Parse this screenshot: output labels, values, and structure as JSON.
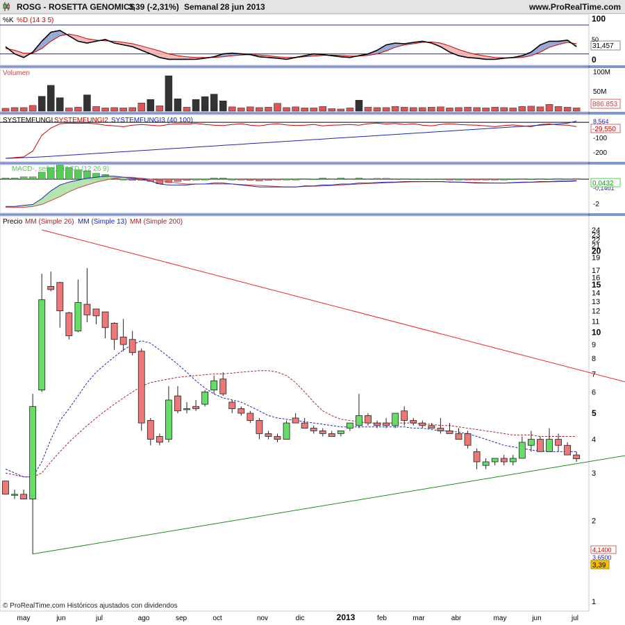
{
  "header": {
    "symbol": "ROSG - ROSETTA GENOMICS",
    "price": "3,39 (-2,31%)",
    "period": "Semanal",
    "date": "28 jun 2013",
    "site": "www.ProRealTime.com"
  },
  "panels": {
    "stochastic": {
      "label_k": "%K",
      "label_d": "%D (14 3 5)",
      "value_label": "31,457",
      "ticks": [
        "100",
        "50",
        "0"
      ],
      "colors": {
        "k": "#000000",
        "d": "#cc0000",
        "fill_up": "#8f9fcf",
        "fill_down": "#f0b4b4"
      }
    },
    "volume": {
      "label": "Volumen",
      "value_label": "886.853",
      "ticks": [
        "100M",
        "50M"
      ]
    },
    "systemfungi": {
      "label_1": "SYSTEMFUNGI",
      "label_2": "SYSTEMFUNGI2",
      "label_3": "SYSTEMFUNGI3 (40 100)",
      "value_label_blue": "8,564",
      "value_label_red": "-29,550",
      "ticks": [
        "0",
        "-100",
        "-200"
      ],
      "colors": {
        "red": "#cc0000",
        "blue": "#1f24b3"
      }
    },
    "macd": {
      "label": "MACD-, señal, MACD (12 26 9)",
      "value_label": "0,0432",
      "value_label_under": "-0,1401",
      "ticks": [
        "0",
        "-2"
      ],
      "colors": {
        "hist_pos": "#55cc55",
        "hist_neg": "#e07070"
      }
    },
    "price": {
      "label_prefix": "Precio",
      "label_mm26": "MM (Simple 26)",
      "label_mm13": "MM (Simple 13)",
      "label_mm200": "MM (Simple 200)",
      "value_label_1": "4,1400",
      "value_label_2": "3,6500",
      "value_label_last": "3,39",
      "ticks": [
        "24",
        "23",
        "22",
        "21",
        "20",
        "19",
        "17",
        "16",
        "15",
        "14",
        "13",
        "12",
        "11",
        "10",
        "9",
        "8",
        "7",
        "6",
        "5",
        "4",
        "3",
        "2",
        "1"
      ],
      "colors": {
        "up": "#66dd66",
        "down": "#ee7777",
        "trend_red": "#ee2222",
        "trend_green": "#228822",
        "mm13": "#1f24b3",
        "mm26": "#aa2222",
        "last": "#f5c000"
      }
    }
  },
  "footer": {
    "copyright": "© ProRealTime.com Históricos ajustados con dividendos"
  },
  "xaxis": {
    "labels": [
      "may",
      "jun",
      "jul",
      "ago",
      "sep",
      "oct",
      "nov",
      "dic",
      "2013",
      "feb",
      "mar",
      "abr",
      "may",
      "jun",
      "jul"
    ]
  },
  "chart_data": [
    {
      "type": "candlestick",
      "title": "ROSG - ROSETTA GENOMICS",
      "period": "Semanal",
      "ylim": [
        1,
        24
      ],
      "y_scale": "log",
      "x_labels": [
        "may",
        "jun",
        "jul",
        "ago",
        "sep",
        "oct",
        "nov",
        "dic",
        "2013",
        "feb",
        "mar",
        "abr",
        "may",
        "jun",
        "jul"
      ],
      "candles": [
        {
          "o": 2.8,
          "h": 2.8,
          "l": 2.5,
          "c": 2.5
        },
        {
          "o": 2.5,
          "h": 2.6,
          "l": 2.4,
          "c": 2.5
        },
        {
          "o": 2.5,
          "h": 2.6,
          "l": 2.4,
          "c": 2.4
        },
        {
          "o": 2.4,
          "h": 5.9,
          "l": 1.5,
          "c": 5.3
        },
        {
          "o": 6.1,
          "h": 16.5,
          "l": 6.0,
          "c": 13.2
        },
        {
          "o": 14.8,
          "h": 16.8,
          "l": 14.2,
          "c": 14.4
        },
        {
          "o": 15.3,
          "h": 15.4,
          "l": 10.4,
          "c": 12.0
        },
        {
          "o": 11.8,
          "h": 11.9,
          "l": 9.4,
          "c": 9.7
        },
        {
          "o": 10.1,
          "h": 15.7,
          "l": 10.0,
          "c": 12.9
        },
        {
          "o": 12.7,
          "h": 17.3,
          "l": 10.9,
          "c": 11.6
        },
        {
          "o": 12.2,
          "h": 12.2,
          "l": 10.7,
          "c": 11.5
        },
        {
          "o": 11.9,
          "h": 11.9,
          "l": 9.5,
          "c": 10.4
        },
        {
          "o": 10.8,
          "h": 10.9,
          "l": 8.6,
          "c": 9.4
        },
        {
          "o": 9.6,
          "h": 11.2,
          "l": 8.5,
          "c": 9.0
        },
        {
          "o": 9.4,
          "h": 10.1,
          "l": 8.2,
          "c": 8.4
        },
        {
          "o": 8.5,
          "h": 8.7,
          "l": 4.3,
          "c": 4.6
        },
        {
          "o": 4.7,
          "h": 4.8,
          "l": 3.8,
          "c": 4.0
        },
        {
          "o": 4.1,
          "h": 4.2,
          "l": 3.8,
          "c": 3.9
        },
        {
          "o": 4.0,
          "h": 6.3,
          "l": 3.9,
          "c": 5.6
        },
        {
          "o": 5.8,
          "h": 6.3,
          "l": 5.0,
          "c": 5.1
        },
        {
          "o": 5.2,
          "h": 5.5,
          "l": 5.0,
          "c": 5.2
        },
        {
          "o": 5.3,
          "h": 5.6,
          "l": 5.1,
          "c": 5.2
        },
        {
          "o": 5.4,
          "h": 6.1,
          "l": 5.3,
          "c": 6.0
        },
        {
          "o": 6.1,
          "h": 6.9,
          "l": 5.9,
          "c": 6.6
        },
        {
          "o": 6.7,
          "h": 7.1,
          "l": 5.8,
          "c": 5.9
        },
        {
          "o": 5.5,
          "h": 5.6,
          "l": 5.0,
          "c": 5.2
        },
        {
          "o": 5.2,
          "h": 5.3,
          "l": 4.9,
          "c": 5.0
        },
        {
          "o": 5.0,
          "h": 5.1,
          "l": 4.6,
          "c": 4.7
        },
        {
          "o": 4.7,
          "h": 4.8,
          "l": 4.0,
          "c": 4.2
        },
        {
          "o": 4.2,
          "h": 4.3,
          "l": 4.0,
          "c": 4.1
        },
        {
          "o": 4.1,
          "h": 4.2,
          "l": 3.9,
          "c": 4.0
        },
        {
          "o": 4.0,
          "h": 4.7,
          "l": 4.0,
          "c": 4.6
        },
        {
          "o": 4.8,
          "h": 5.0,
          "l": 4.6,
          "c": 4.6
        },
        {
          "o": 4.6,
          "h": 4.8,
          "l": 4.4,
          "c": 4.4
        },
        {
          "o": 4.4,
          "h": 4.5,
          "l": 4.2,
          "c": 4.3
        },
        {
          "o": 4.3,
          "h": 4.4,
          "l": 4.1,
          "c": 4.2
        },
        {
          "o": 4.2,
          "h": 4.3,
          "l": 4.1,
          "c": 4.1
        },
        {
          "o": 4.2,
          "h": 4.3,
          "l": 4.1,
          "c": 4.3
        },
        {
          "o": 4.4,
          "h": 4.6,
          "l": 4.3,
          "c": 4.6
        },
        {
          "o": 4.5,
          "h": 5.9,
          "l": 4.4,
          "c": 4.9
        },
        {
          "o": 4.9,
          "h": 5.0,
          "l": 4.5,
          "c": 4.6
        },
        {
          "o": 4.6,
          "h": 4.7,
          "l": 4.4,
          "c": 4.5
        },
        {
          "o": 4.6,
          "h": 4.8,
          "l": 4.4,
          "c": 4.5
        },
        {
          "o": 4.5,
          "h": 5.0,
          "l": 4.4,
          "c": 5.0
        },
        {
          "o": 5.1,
          "h": 5.3,
          "l": 4.5,
          "c": 4.7
        },
        {
          "o": 4.7,
          "h": 4.8,
          "l": 4.5,
          "c": 4.6
        },
        {
          "o": 4.6,
          "h": 4.7,
          "l": 4.4,
          "c": 4.5
        },
        {
          "o": 4.5,
          "h": 4.6,
          "l": 4.4,
          "c": 4.4
        },
        {
          "o": 4.4,
          "h": 4.8,
          "l": 4.2,
          "c": 4.3
        },
        {
          "o": 4.3,
          "h": 4.6,
          "l": 4.2,
          "c": 4.2
        },
        {
          "o": 4.2,
          "h": 4.4,
          "l": 4.0,
          "c": 4.0
        },
        {
          "o": 4.2,
          "h": 4.3,
          "l": 3.7,
          "c": 3.8
        },
        {
          "o": 3.6,
          "h": 3.7,
          "l": 3.1,
          "c": 3.3
        },
        {
          "o": 3.2,
          "h": 3.4,
          "l": 3.1,
          "c": 3.3
        },
        {
          "o": 3.3,
          "h": 3.4,
          "l": 3.2,
          "c": 3.4
        },
        {
          "o": 3.4,
          "h": 3.5,
          "l": 3.2,
          "c": 3.3
        },
        {
          "o": 3.3,
          "h": 3.5,
          "l": 3.2,
          "c": 3.4
        },
        {
          "o": 3.4,
          "h": 4.1,
          "l": 3.4,
          "c": 3.9
        },
        {
          "o": 3.8,
          "h": 4.3,
          "l": 3.6,
          "c": 4.0
        },
        {
          "o": 4.0,
          "h": 4.1,
          "l": 3.6,
          "c": 3.6
        },
        {
          "o": 3.6,
          "h": 4.4,
          "l": 3.6,
          "c": 4.0
        },
        {
          "o": 4.0,
          "h": 4.2,
          "l": 3.6,
          "c": 3.8
        },
        {
          "o": 3.8,
          "h": 3.9,
          "l": 3.5,
          "c": 3.5
        },
        {
          "o": 3.5,
          "h": 3.6,
          "l": 3.3,
          "c": 3.39
        }
      ],
      "mm13": [
        3.1,
        3.0,
        2.9,
        2.9,
        3.3,
        4.0,
        4.7,
        5.2,
        5.8,
        6.5,
        7.1,
        7.6,
        8.1,
        8.6,
        9.0,
        9.3,
        9.1,
        8.6,
        8.1,
        7.6,
        7.1,
        6.6,
        6.2,
        5.9,
        5.7,
        5.6,
        5.5,
        5.3,
        5.1,
        4.9,
        4.8,
        4.75,
        4.7,
        4.65,
        4.6,
        4.55,
        4.5,
        4.45,
        4.45,
        4.45,
        4.45,
        4.45,
        4.45,
        4.45,
        4.45,
        4.4,
        4.4,
        4.35,
        4.3,
        4.3,
        4.25,
        4.2,
        4.1,
        4.0,
        3.9,
        3.8,
        3.75,
        3.7,
        3.65,
        3.62,
        3.6,
        3.6,
        3.6,
        3.6
      ],
      "mm26": [
        3.0,
        2.95,
        2.9,
        2.9,
        3.0,
        3.3,
        3.6,
        3.9,
        4.2,
        4.5,
        4.8,
        5.1,
        5.4,
        5.7,
        6.0,
        6.3,
        6.5,
        6.6,
        6.7,
        6.8,
        6.85,
        6.9,
        6.95,
        7.0,
        7.0,
        7.05,
        7.1,
        7.15,
        7.2,
        7.2,
        7.1,
        6.9,
        6.5,
        6.0,
        5.5,
        5.1,
        4.9,
        4.75,
        4.7,
        4.65,
        4.6,
        4.6,
        4.6,
        4.6,
        4.6,
        4.6,
        4.55,
        4.55,
        4.5,
        4.5,
        4.45,
        4.4,
        4.35,
        4.3,
        4.25,
        4.2,
        4.15,
        4.15,
        4.15,
        4.1,
        4.1,
        4.1,
        4.1,
        4.1
      ],
      "trend_red": {
        "from": {
          "i": 4,
          "price": 24
        },
        "to": {
          "i": 71,
          "price": 6.2
        }
      },
      "trend_green": {
        "from": {
          "i": 3,
          "price": 1.5
        },
        "to": {
          "i": 71,
          "price": 3.6
        }
      }
    },
    {
      "type": "bar",
      "title": "Volumen",
      "values": [
        0.8,
        1,
        1,
        1.6,
        4.2,
        7.3,
        3.8,
        0.9,
        1.1,
        4.6,
        1.3,
        0.9,
        1,
        0.9,
        1,
        2.3,
        3.3,
        1.5,
        10,
        3.5,
        1.1,
        3.3,
        4.1,
        4.8,
        2.9,
        1.2,
        0.9,
        1.2,
        1,
        1.1,
        2.2,
        1,
        1.2,
        0.9,
        0.9,
        1.3,
        0.7,
        0.6,
        0.9,
        3.1,
        1.1,
        1,
        1,
        1.3,
        1.1,
        1,
        1,
        1.1,
        1.2,
        0.9,
        1,
        1.1,
        1,
        0.9,
        1.1,
        1,
        0.9,
        1.3,
        1.4,
        1.2,
        1.9,
        1.3,
        1.1,
        0.9
      ],
      "last_value": "886.853"
    },
    {
      "type": "line",
      "title": "%K %D (14 3 5)",
      "ylim": [
        0,
        100
      ],
      "series": [
        {
          "name": "%K",
          "values": [
            40,
            20,
            10,
            25,
            55,
            80,
            85,
            70,
            55,
            50,
            55,
            60,
            50,
            45,
            40,
            30,
            20,
            10,
            5,
            5,
            5,
            5,
            8,
            12,
            20,
            22,
            20,
            18,
            12,
            10,
            8,
            5,
            10,
            15,
            20,
            18,
            15,
            12,
            10,
            15,
            20,
            30,
            45,
            50,
            48,
            52,
            55,
            50,
            40,
            25,
            15,
            10,
            8,
            5,
            5,
            8,
            10,
            15,
            25,
            45,
            55,
            55,
            58,
            40
          ]
        },
        {
          "name": "%D",
          "values": [
            35,
            30,
            22,
            22,
            35,
            55,
            70,
            75,
            70,
            62,
            58,
            56,
            55,
            52,
            48,
            42,
            35,
            28,
            20,
            15,
            12,
            10,
            10,
            10,
            12,
            15,
            17,
            18,
            17,
            15,
            12,
            10,
            10,
            12,
            14,
            16,
            17,
            16,
            14,
            14,
            16,
            20,
            28,
            38,
            45,
            48,
            52,
            53,
            50,
            42,
            32,
            24,
            18,
            14,
            10,
            9,
            9,
            10,
            15,
            25,
            38,
            46,
            52,
            48
          ]
        }
      ],
      "last_value": "31,457"
    },
    {
      "type": "line",
      "title": "SYSTEMFUNGI SYSTEMFUNGI2 SYSTEMFUNGI3 (40 100)",
      "ylim": [
        -250,
        20
      ],
      "series": [
        {
          "name": "SYSTEMFUNGI2",
          "values": [
            -250,
            -245,
            -240,
            -200,
            -90,
            -40,
            -10,
            -5,
            -8,
            -5,
            -10,
            -20,
            -25,
            -30,
            -20,
            -15,
            -20,
            -25,
            -15,
            -10,
            -12,
            -8,
            -15,
            -20,
            -22,
            -15,
            -10,
            -20,
            -25,
            -15,
            -10,
            -18,
            -22,
            -20,
            -15,
            -25,
            -20,
            -18,
            -15,
            -20,
            -10,
            -5,
            -12,
            -8,
            -15,
            -10,
            -20,
            -25,
            -15,
            -10,
            -15,
            -18,
            -20,
            -25,
            -30,
            -22,
            -18,
            -25,
            -30,
            -15,
            -12,
            -18,
            -20,
            -29.55
          ]
        },
        {
          "name": "SYSTEMFUNGI3",
          "values": [
            -250,
            -248,
            -245,
            -243,
            -240,
            -236,
            -232,
            -228,
            -224,
            -220,
            -216,
            -212,
            -208,
            -204,
            -200,
            -196,
            -192,
            -188,
            -184,
            -180,
            -176,
            -172,
            -168,
            -164,
            -160,
            -156,
            -152,
            -148,
            -144,
            -140,
            -136,
            -132,
            -128,
            -124,
            -120,
            -116,
            -112,
            -108,
            -104,
            -100,
            -96,
            -92,
            -88,
            -84,
            -80,
            -76,
            -72,
            -68,
            -64,
            -60,
            -56,
            -52,
            -48,
            -44,
            -40,
            -36,
            -32,
            -28,
            -24,
            -20,
            -16,
            -12,
            -6,
            8.564
          ]
        }
      ]
    },
    {
      "type": "line",
      "title": "MACD-, señal, MACD (12 26 9)",
      "ylim": [
        -3,
        1
      ],
      "series": [
        {
          "name": "MACD",
          "values": [
            -2.8,
            -2.8,
            -2.7,
            -2.6,
            -2.0,
            -1.2,
            -0.6,
            -0.3,
            -0.1,
            0.1,
            0.2,
            0.3,
            0.3,
            0.2,
            0.1,
            0,
            -0.2,
            -0.5,
            -0.6,
            -0.6,
            -0.6,
            -0.5,
            -0.5,
            -0.4,
            -0.4,
            -0.5,
            -0.6,
            -0.7,
            -0.8,
            -0.8,
            -0.8,
            -0.8,
            -0.8,
            -0.7,
            -0.7,
            -0.6,
            -0.6,
            -0.5,
            -0.5,
            -0.4,
            -0.4,
            -0.35,
            -0.3,
            -0.3,
            -0.25,
            -0.25,
            -0.25,
            -0.25,
            -0.25,
            -0.3,
            -0.3,
            -0.35,
            -0.4,
            -0.4,
            -0.4,
            -0.4,
            -0.35,
            -0.3,
            -0.3,
            -0.25,
            -0.25,
            -0.2,
            -0.2,
            -0.1401
          ]
        },
        {
          "name": "señal",
          "values": [
            -2.9,
            -2.9,
            -2.9,
            -2.8,
            -2.6,
            -2.2,
            -1.8,
            -1.3,
            -0.9,
            -0.6,
            -0.3,
            -0.1,
            0.1,
            0.2,
            0.2,
            0.1,
            0,
            -0.1,
            -0.3,
            -0.4,
            -0.5,
            -0.5,
            -0.5,
            -0.5,
            -0.5,
            -0.5,
            -0.55,
            -0.6,
            -0.65,
            -0.7,
            -0.75,
            -0.8,
            -0.8,
            -0.75,
            -0.72,
            -0.7,
            -0.65,
            -0.6,
            -0.55,
            -0.5,
            -0.45,
            -0.42,
            -0.38,
            -0.34,
            -0.3,
            -0.28,
            -0.27,
            -0.27,
            -0.27,
            -0.28,
            -0.3,
            -0.32,
            -0.35,
            -0.38,
            -0.39,
            -0.4,
            -0.38,
            -0.35,
            -0.32,
            -0.3,
            -0.28,
            -0.26,
            -0.24,
            -0.2
          ]
        }
      ],
      "last_value": "0,0432"
    }
  ]
}
